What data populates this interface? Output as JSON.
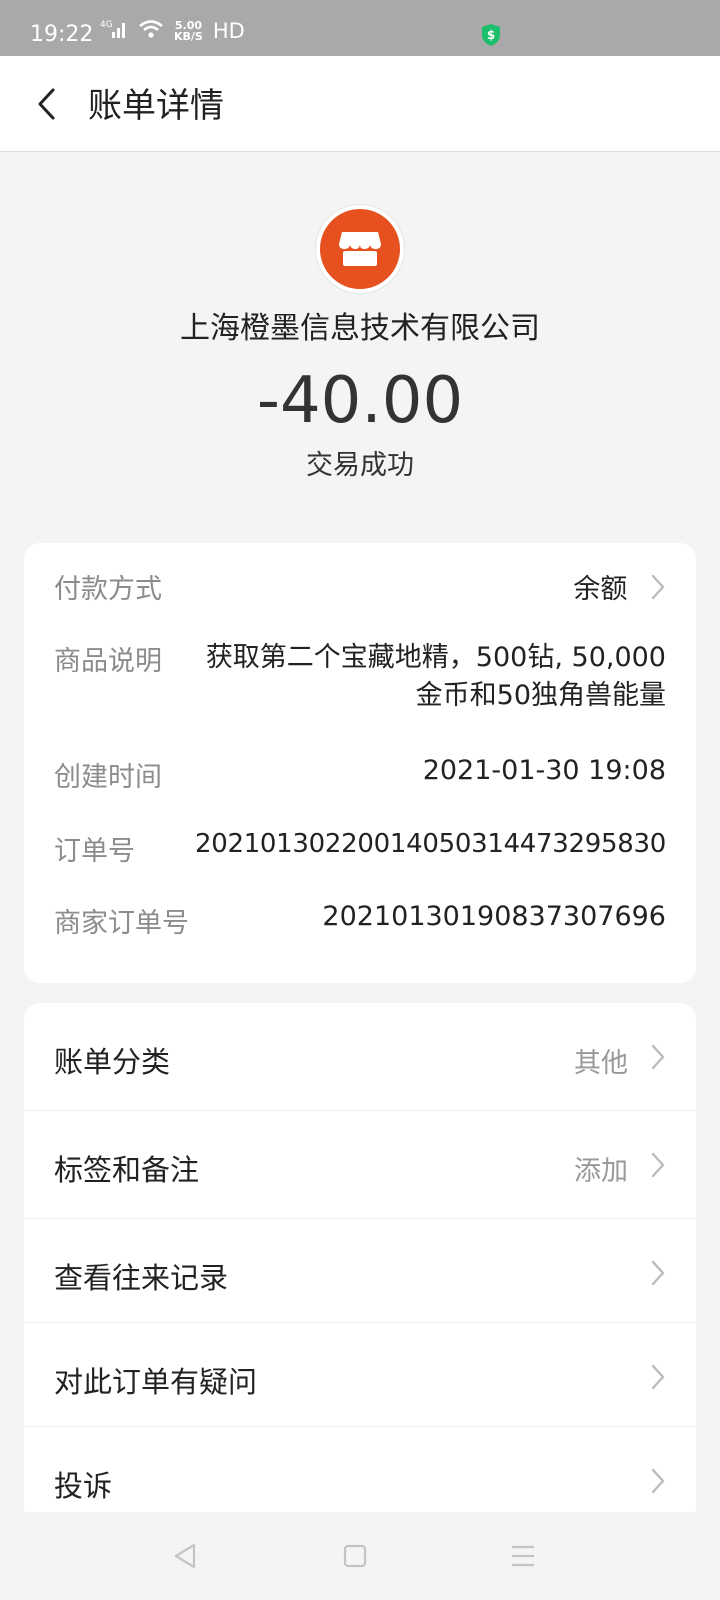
{
  "status_bar": {
    "time": "19:22",
    "signal": "4G",
    "speed_value": "5.00",
    "speed_unit": "KB/S",
    "hd": "HD"
  },
  "title_bar": {
    "title": "账单详情"
  },
  "header": {
    "merchant_name": "上海橙墨信息技术有限公司",
    "amount": "-40.00",
    "status": "交易成功",
    "logo_color": "#e7511f"
  },
  "details": {
    "payment_method": {
      "label": "付款方式",
      "value": "余额"
    },
    "description": {
      "label": "商品说明",
      "value": "获取第二个宝藏地精，500钻, 50,000金币和50独角兽能量"
    },
    "created_time": {
      "label": "创建时间",
      "value": "2021-01-30 19:08"
    },
    "order_no": {
      "label": "订单号",
      "value": "20210130220014050314473295830"
    },
    "merchant_order_no": {
      "label": "商家订单号",
      "value": "20210130190837307696"
    }
  },
  "menu": {
    "category": {
      "label": "账单分类",
      "value": "其他"
    },
    "tags": {
      "label": "标签和备注",
      "value": "添加"
    },
    "history": {
      "label": "查看往来记录"
    },
    "question": {
      "label": "对此订单有疑问"
    },
    "complaint": {
      "label": "投诉"
    }
  },
  "icons": {
    "back": "chevron-left-icon",
    "shield": "shield-dollar-icon",
    "chevron": "chevron-right-icon",
    "nav_back": "triangle-back-icon",
    "nav_home": "square-home-icon",
    "nav_menu": "menu-lines-icon"
  }
}
